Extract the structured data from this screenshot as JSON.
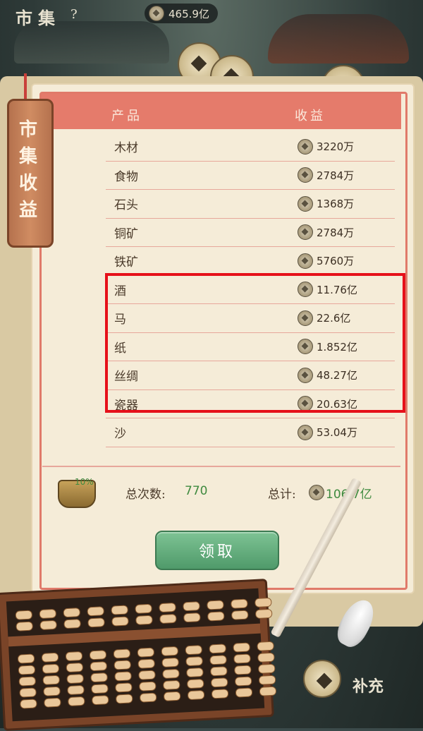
{
  "top_bar": {
    "title": "市集",
    "help": "?",
    "currency_value": "465.9亿"
  },
  "bookmark": {
    "label": "市集收益"
  },
  "table": {
    "header_product": "产品",
    "header_income": "收益",
    "rows": [
      {
        "product": "木材",
        "income": "3220万"
      },
      {
        "product": "食物",
        "income": "2784万"
      },
      {
        "product": "石头",
        "income": "1368万"
      },
      {
        "product": "铜矿",
        "income": "2784万"
      },
      {
        "product": "铁矿",
        "income": "5760万"
      },
      {
        "product": "酒",
        "income": "11.76亿"
      },
      {
        "product": "马",
        "income": "22.6亿"
      },
      {
        "product": "纸",
        "income": "1.852亿"
      },
      {
        "product": "丝绸",
        "income": "48.27亿"
      },
      {
        "product": "瓷器",
        "income": "20.63亿"
      },
      {
        "product": "沙",
        "income": "53.04万"
      }
    ]
  },
  "summary": {
    "bonus": "10%",
    "count_label": "总次数:",
    "count_value": "770",
    "total_label": "总计:",
    "total_value": "106.7亿"
  },
  "claim_button": "领取",
  "bottom_right": {
    "label": "补充"
  },
  "colors": {
    "header_band": "#e57b6b",
    "page": "#f5ecd8",
    "highlight": "#e6101a",
    "green_value": "#3f8a3f",
    "claim_button": "#5fae7a"
  }
}
